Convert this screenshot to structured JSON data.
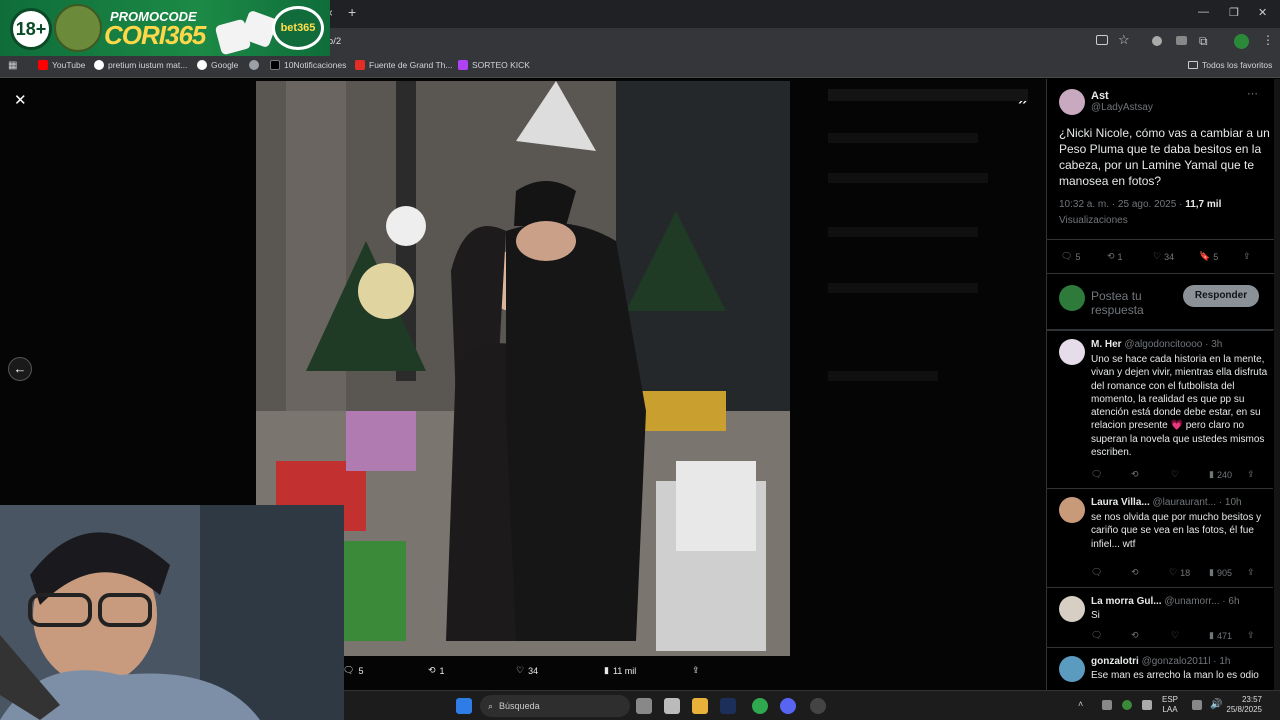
{
  "promo": {
    "badge": "18+",
    "line1": "PROMOCODE",
    "line2": "CORI365",
    "bet": "bet365"
  },
  "browser": {
    "url_fragment": "oto/2",
    "new_tab": "+",
    "close_tab": "×"
  },
  "bookmarks": [
    {
      "label": "YouTube",
      "color": "#ff0000"
    },
    {
      "label": "pretium iustum mat...",
      "color": "#ffffff"
    },
    {
      "label": "Google",
      "color": "#ffffff"
    },
    {
      "label": "",
      "color": "#9aa0a6"
    },
    {
      "label": "10Notificaciones",
      "color": "#000000"
    },
    {
      "label": "Fuente de Grand Th...",
      "color": "#e52d27"
    },
    {
      "label": "SORTEO KICK",
      "color": "#b042f5"
    }
  ],
  "bookmarks_right": "Todos los favoritos",
  "tweet": {
    "name": "Ast",
    "handle": "@LadyAstsay",
    "text": "¿Nicki Nicole, cómo vas a cambiar a un Peso Pluma que te daba besitos en la cabeza, por un Lamine Yamal que te manosea en fotos?",
    "time": "10:32 a. m. · 25 ago. 2025 · ",
    "views": "11,7 mil",
    "views_label": "Visualizaciones",
    "replies": "5",
    "retweets": "1",
    "likes": "34",
    "bookmarks": "5",
    "reply_placeholder": "Postea tu respuesta",
    "reply_button": "Responder"
  },
  "replies": [
    {
      "name": "M. Her",
      "handle": "@algodoncitoooo · 3h",
      "text": "Uno se hace cada historia en la mente, vivan y dejen vivir, mientras ella disfruta del romance con el futbolista del momento, la realidad es que pp su atención está donde debe estar, en su relacion presente 💗 pero claro no superan la novela que ustedes mismos escriben.",
      "views": "240",
      "likes": "",
      "retweets": ""
    },
    {
      "name": "Laura Villa...",
      "handle": "@lauraurant... · 10h",
      "text": "se nos olvida que por mucho besitos y cariño que se vea en las fotos, él fue infiel... wtf",
      "views": "905",
      "likes": "18",
      "retweets": ""
    },
    {
      "name": "La morra Gul...",
      "handle": "@unamorr... · 6h",
      "text": "Si",
      "views": "471",
      "likes": "",
      "retweets": ""
    },
    {
      "name": "gonzalotri",
      "handle": "@gonzalo2011l · 1h",
      "text": "Ese man es arrecho la man lo es odio",
      "views": "",
      "likes": "",
      "retweets": ""
    }
  ],
  "photo_actions": {
    "replies": "5",
    "retweets": "1",
    "likes": "34",
    "views": "11 mil"
  },
  "taskbar": {
    "search": "Búsqueda",
    "lang1": "ESP",
    "lang2": "LAA",
    "time": "23:57",
    "date": "25/8/2025"
  }
}
